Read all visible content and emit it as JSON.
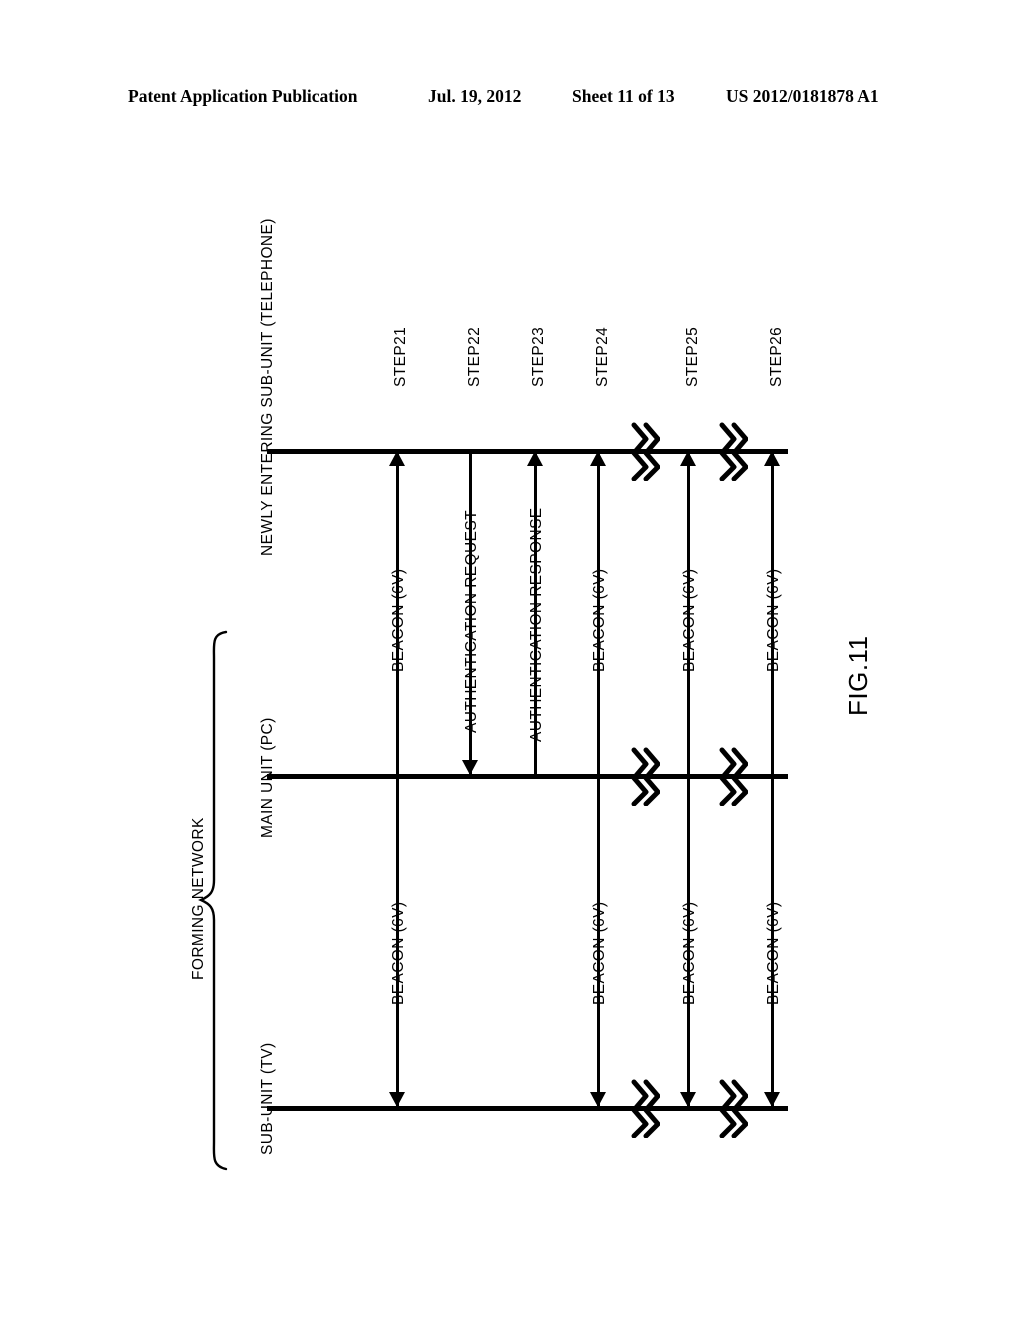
{
  "header": {
    "title": "Patent Application Publication",
    "date": "Jul. 19, 2012",
    "sheet": "Sheet 11 of 13",
    "publication_number": "US 2012/0181878 A1"
  },
  "figure": {
    "caption": "FIG.11",
    "group_label": "FORMING NETWORK",
    "lifelines": [
      {
        "id": "newly-entering",
        "label": "NEWLY ENTERING SUB-UNIT (TELEPHONE)"
      },
      {
        "id": "main-unit",
        "label": "MAIN UNIT (PC)"
      },
      {
        "id": "sub-unit",
        "label": "SUB-UNIT (TV)"
      }
    ],
    "steps": [
      {
        "id": "step21",
        "label": "STEP21"
      },
      {
        "id": "step22",
        "label": "STEP22"
      },
      {
        "id": "step23",
        "label": "STEP23"
      },
      {
        "id": "step24",
        "label": "STEP24"
      },
      {
        "id": "step25",
        "label": "STEP25"
      },
      {
        "id": "step26",
        "label": "STEP26"
      }
    ],
    "messages_upper": [
      {
        "id": "m-u1",
        "label": "BEACON  (6V)"
      },
      {
        "id": "m-u2",
        "label": "AUTHENTICATION REQUEST"
      },
      {
        "id": "m-u3",
        "label": "AUTHENTICATION RESPONSE"
      },
      {
        "id": "m-u4",
        "label": "BEACON  (6V)"
      },
      {
        "id": "m-u5",
        "label": "BEACON  (6V)"
      },
      {
        "id": "m-u6",
        "label": "BEACON  (6V)"
      }
    ],
    "messages_lower": [
      {
        "id": "m-l1",
        "label": "BEACON  (6V)"
      },
      {
        "id": "m-l2",
        "label": "BEACON  (6V)"
      },
      {
        "id": "m-l3",
        "label": "BEACON  (6V)"
      },
      {
        "id": "m-l4",
        "label": "BEACON  (6V)"
      }
    ]
  },
  "chart_data": {
    "type": "diagram",
    "title": "FIG.11",
    "diagram_kind": "sequence-diagram",
    "orientation": "rotated-90-counterclockwise",
    "participants": [
      "NEWLY ENTERING SUB-UNIT (TELEPHONE)",
      "MAIN UNIT (PC)",
      "SUB-UNIT (TV)"
    ],
    "grouped_participants": {
      "label": "FORMING NETWORK",
      "members": [
        "MAIN UNIT (PC)",
        "SUB-UNIT (TV)"
      ]
    },
    "messages": [
      {
        "step": "STEP21",
        "label": "BEACON  (6V)",
        "from": "SUB-UNIT (TV)",
        "to": "NEWLY ENTERING SUB-UNIT (TELEPHONE)",
        "bidirectional": true
      },
      {
        "step": "STEP22",
        "label": "AUTHENTICATION REQUEST",
        "from": "NEWLY ENTERING SUB-UNIT (TELEPHONE)",
        "to": "MAIN UNIT (PC)",
        "bidirectional": false
      },
      {
        "step": "STEP23",
        "label": "AUTHENTICATION RESPONSE",
        "from": "MAIN UNIT (PC)",
        "to": "NEWLY ENTERING SUB-UNIT (TELEPHONE)",
        "bidirectional": false
      },
      {
        "step": "STEP24",
        "label": "BEACON  (6V)",
        "from": "SUB-UNIT (TV)",
        "to": "NEWLY ENTERING SUB-UNIT (TELEPHONE)",
        "bidirectional": true
      },
      {
        "step": "STEP25",
        "label": "BEACON  (6V)",
        "from": "SUB-UNIT (TV)",
        "to": "NEWLY ENTERING SUB-UNIT (TELEPHONE)",
        "bidirectional": true
      },
      {
        "step": "STEP26",
        "label": "BEACON  (6V)",
        "from": "SUB-UNIT (TV)",
        "to": "NEWLY ENTERING SUB-UNIT (TELEPHONE)",
        "bidirectional": true
      }
    ],
    "break_marks": 6,
    "line_color": "#000000",
    "background": "#ffffff"
  }
}
